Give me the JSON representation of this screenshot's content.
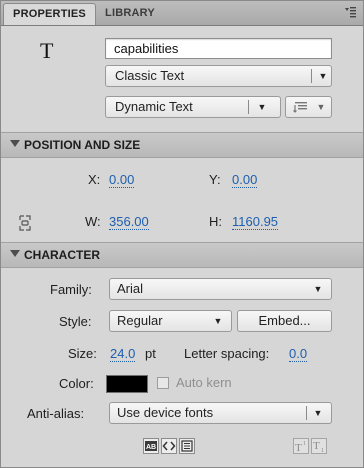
{
  "tabs": [
    {
      "label": "PROPERTIES",
      "active": true
    },
    {
      "label": "LIBRARY",
      "active": false
    }
  ],
  "panel_menu_icon": "panel-menu-icon",
  "instance": {
    "type_glyph": "T",
    "name_value": "capabilities",
    "text_engine": "Classic Text",
    "text_type": "Dynamic Text",
    "orientation_icon": "text-orientation-icon"
  },
  "position_size": {
    "title": "POSITION AND SIZE",
    "x_label": "X:",
    "x_value": "0.00",
    "y_label": "Y:",
    "y_value": "0.00",
    "w_label": "W:",
    "w_value": "356.00",
    "h_label": "H:",
    "h_value": "1160.95",
    "lock_icon": "link-lock-icon"
  },
  "character": {
    "title": "CHARACTER",
    "family_label": "Family:",
    "family_value": "Arial",
    "style_label": "Style:",
    "style_value": "Regular",
    "embed_label": "Embed...",
    "size_label": "Size:",
    "size_value": "24.0",
    "size_unit": "pt",
    "letter_spacing_label": "Letter spacing:",
    "letter_spacing_value": "0.0",
    "color_label": "Color:",
    "color_value": "#000000",
    "auto_kern_label": "Auto kern",
    "auto_kern_checked": false,
    "anti_alias_label": "Anti-alias:",
    "anti_alias_value": "Use device fonts"
  },
  "bottom_icons": [
    "selectable-icon",
    "render-html-icon",
    "border-icon",
    "superscript-icon",
    "subscript-icon"
  ]
}
